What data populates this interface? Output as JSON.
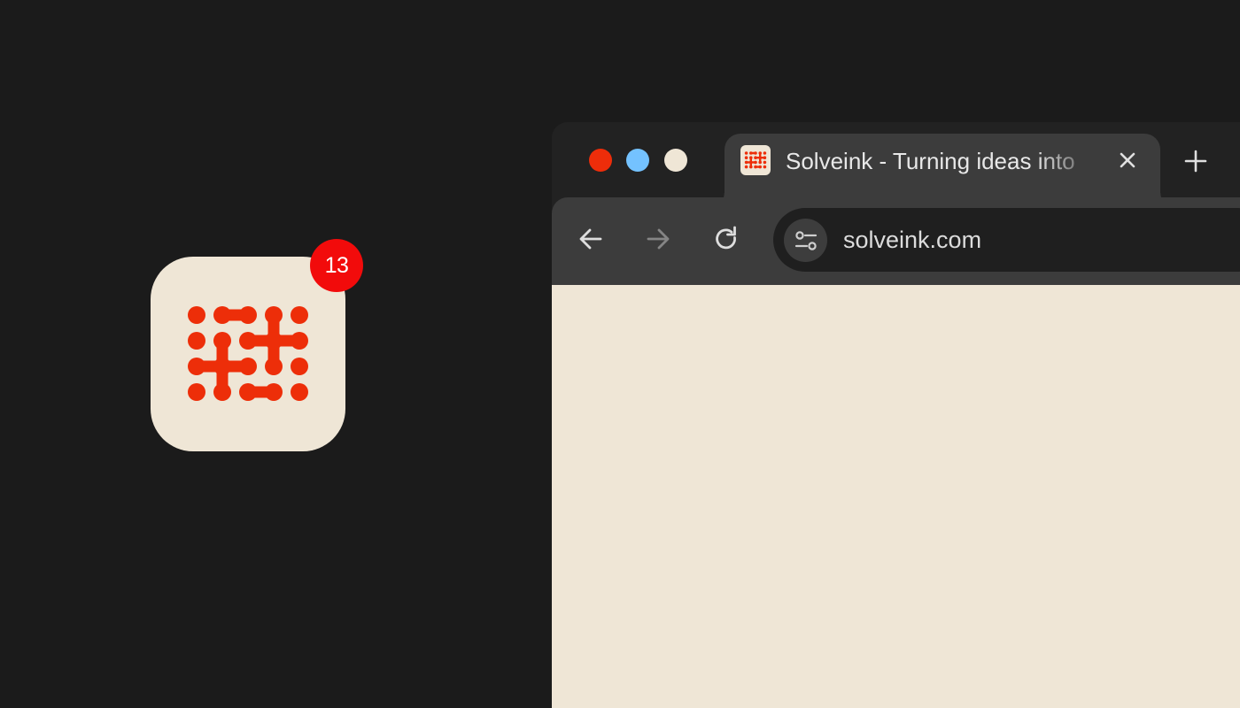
{
  "app_icon": {
    "name": "solveink-logo-icon",
    "badge_count": "13",
    "background_color": "#efe6d6",
    "logo_color": "#ed2e09",
    "badge_color": "#f20b0b"
  },
  "browser": {
    "window_controls": [
      {
        "name": "close",
        "color": "#ee2d0a"
      },
      {
        "name": "minimize",
        "color": "#74c2ff"
      },
      {
        "name": "maximize",
        "color": "#efe6d6"
      }
    ],
    "tab": {
      "title": "Solveink - Turning ideas into",
      "favicon": "solveink-favicon-icon",
      "close_icon": "close-icon"
    },
    "new_tab_icon": "plus-icon",
    "toolbar": {
      "back_icon": "arrow-left-icon",
      "forward_icon": "arrow-right-icon",
      "forward_enabled": false,
      "reload_icon": "reload-icon",
      "site_settings_icon": "tune-icon",
      "url": "solveink.com"
    },
    "page_background": "#efe6d6"
  }
}
